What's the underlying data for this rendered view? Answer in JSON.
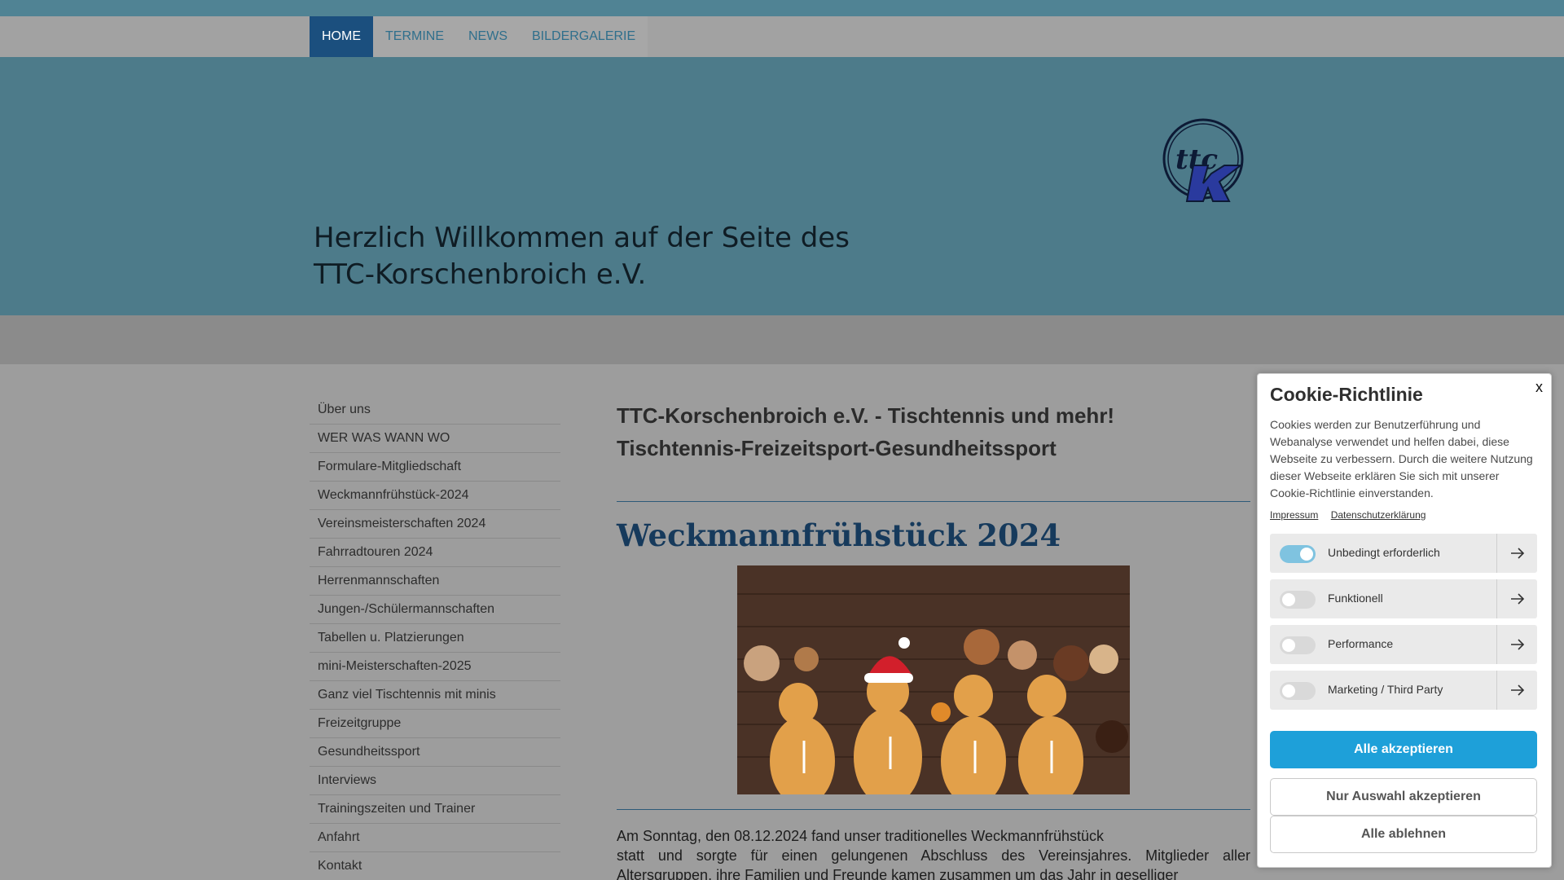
{
  "nav": {
    "items": [
      "HOME",
      "TERMINE",
      "NEWS",
      "BILDERGALERIE"
    ]
  },
  "header": {
    "headline_line1": "Herzlich Willkommen auf der Seite des",
    "headline_line2": "TTC-Korschenbroich e.V.",
    "logo_text": "ttc K"
  },
  "sidebar": {
    "items": [
      "Über uns",
      "WER WAS WANN WO",
      "Formulare-Mitgliedschaft",
      "Weckmannfrühstück-2024",
      "Vereinsmeisterschaften 2024",
      "Fahrradtouren 2024",
      "Herrenmannschaften",
      "Jungen-/Schülermannschaften",
      "Tabellen u. Platzierungen",
      "mini-Meisterschaften-2025",
      "Ganz viel Tischtennis mit minis",
      "Freizeitgruppe",
      "Gesundheitssport",
      "Interviews",
      "Trainingszeiten und Trainer",
      "Anfahrt",
      "Kontakt"
    ]
  },
  "main": {
    "title": "TTC-Korschenbroich e.V. - Tischtennis und mehr!",
    "subtitle": "Tischtennis-Freizeitsport-Gesundheitssport",
    "article_title": "Weckmannfrühstück 2024",
    "para_line1": "Am Sonntag, den 08.12.2024 fand unser traditionelles Weckmannfrühstück",
    "para_rest": "statt und sorgte für einen gelungenen Abschluss des Vereinsjahres. Mitglieder aller Altersgruppen, ihre Familien und Freunde kamen zusammen um das Jahr in geselliger"
  },
  "cookie": {
    "close": "x",
    "title": "Cookie-Richtlinie",
    "text": "Cookies werden zur Benutzerführung und Webanalyse verwendet und helfen dabei, diese Webseite zu verbessern. Durch die weitere Nutzung dieser Webseite erklären Sie sich mit unserer Cookie-Richtlinie einverstanden.",
    "link_impressum": "Impressum",
    "link_datenschutz": "Datenschutzerklärung",
    "categories": [
      {
        "label": "Unbedingt erforderlich",
        "enabled": true
      },
      {
        "label": "Funktionell",
        "enabled": false
      },
      {
        "label": "Performance",
        "enabled": false
      },
      {
        "label": "Marketing / Third Party",
        "enabled": false
      }
    ],
    "btn_accept_all": "Alle akzeptieren",
    "btn_accept_selection": "Nur Auswahl akzeptieren",
    "btn_reject_all": "Alle ablehnen"
  },
  "colors": {
    "nav_active": "#1b4f7e",
    "header_bg": "#4d7b8a",
    "accent_button": "#1ea0d9",
    "article_title": "#163a5c"
  }
}
